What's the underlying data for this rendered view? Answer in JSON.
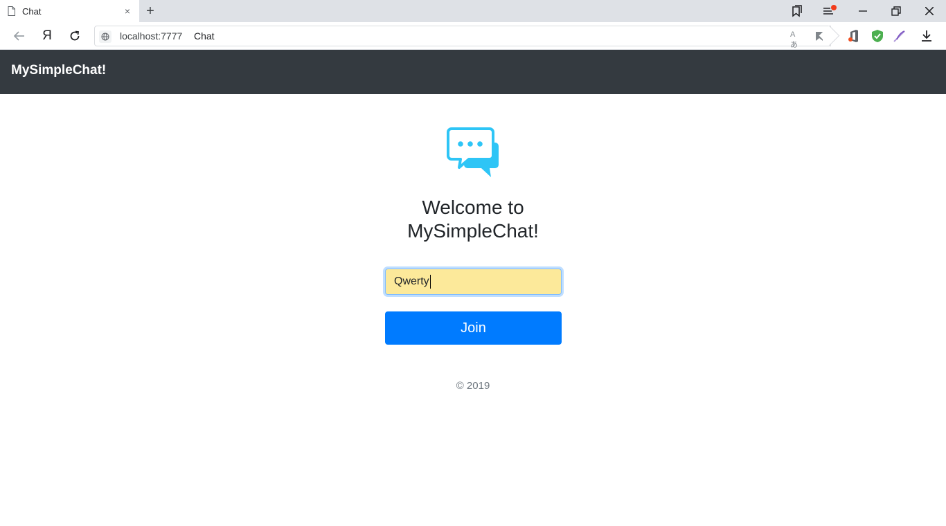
{
  "browser": {
    "tab": {
      "title": "Chat",
      "close_glyph": "×"
    },
    "new_tab_glyph": "+",
    "address_bar": {
      "url": "localhost:7777",
      "page_title": "Chat"
    },
    "translate_glyph": "Aあ",
    "yandex_glyph": "Я"
  },
  "navbar": {
    "brand": "MySimpleChat!"
  },
  "main": {
    "welcome_line1": "Welcome to",
    "welcome_line2": "MySimpleChat!",
    "name_input": {
      "value": "Qwerty"
    },
    "join_label": "Join",
    "footer": "© 2019"
  },
  "colors": {
    "navbar_bg": "#343a40",
    "primary": "#007bff",
    "logo": "#2ec5f6",
    "input_autofill": "#fce99a"
  }
}
